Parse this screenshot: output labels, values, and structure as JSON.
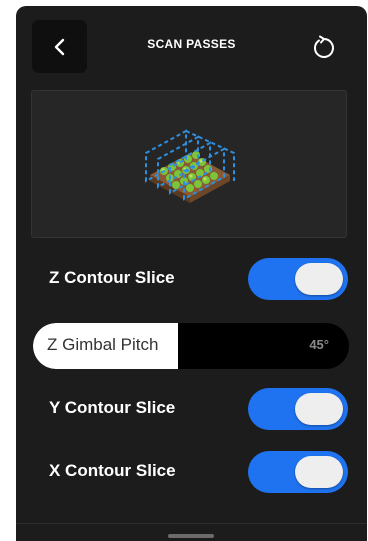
{
  "header": {
    "title": "SCAN PASSES",
    "back_icon": "chevron-left-icon",
    "reset_icon": "refresh-icon"
  },
  "preview": {
    "illustration": "field-scan-illustration"
  },
  "settings": [
    {
      "label": "Z Contour Slice",
      "enabled": true
    },
    {
      "label": "Y Contour Slice",
      "enabled": true
    },
    {
      "label": "X Contour Slice",
      "enabled": true
    }
  ],
  "pitch_slider": {
    "label": "Z Gimbal Pitch",
    "value_text": "45°",
    "fill_fraction": 0.46
  },
  "colors": {
    "panel": "#1c1c1c",
    "toggle_on": "#1f73f0",
    "knob": "#eeeeee",
    "scan_outline": "#2f8fe0"
  }
}
